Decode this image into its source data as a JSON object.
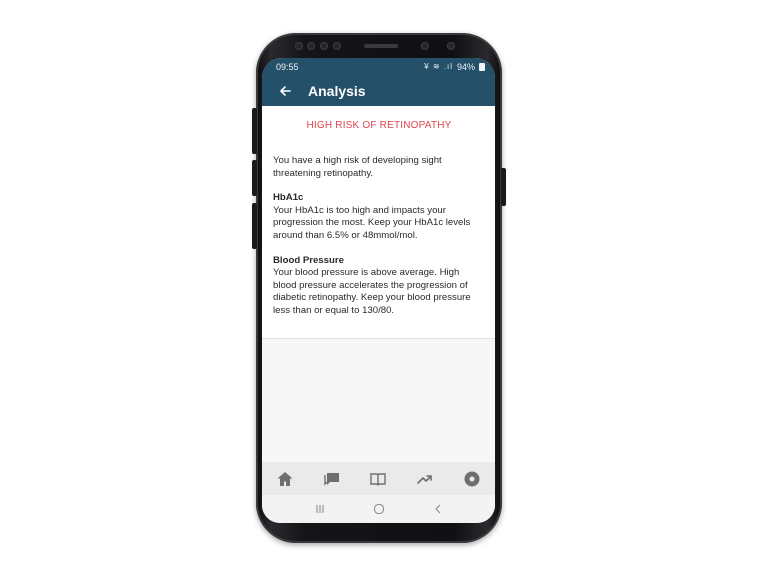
{
  "status_bar": {
    "time": "09:55",
    "signal_icons": "¥ ≋ .ıl",
    "battery_percent": "94%"
  },
  "app_bar": {
    "title": "Analysis",
    "back_icon": "arrow-left-icon"
  },
  "analysis": {
    "risk_title": "HIGH RISK OF RETINOPATHY",
    "summary": "You have a high risk of developing sight threatening retinopathy.",
    "sections": [
      {
        "heading": "HbA1c",
        "body": "Your HbA1c is too high and impacts your progression the most. Keep your HbA1c levels around than 6.5% or 48mmol/mol."
      },
      {
        "heading": "Blood Pressure",
        "body": "Your blood pressure is above average. High blood pressure accelerates the progression of diabetic retinopathy. Keep your blood pressure less than or equal to 130/80."
      }
    ]
  },
  "bottom_tabs": [
    {
      "icon": "home-icon"
    },
    {
      "icon": "chat-icon"
    },
    {
      "icon": "book-icon"
    },
    {
      "icon": "trending-up-icon"
    },
    {
      "icon": "record-icon"
    }
  ],
  "system_nav": [
    {
      "icon": "recent-apps-icon"
    },
    {
      "icon": "home-circle-icon"
    },
    {
      "icon": "back-chevron-icon"
    }
  ],
  "colors": {
    "primary": "#24506a",
    "risk_red": "#e0454f",
    "icon_gray": "#6f6f6f"
  }
}
